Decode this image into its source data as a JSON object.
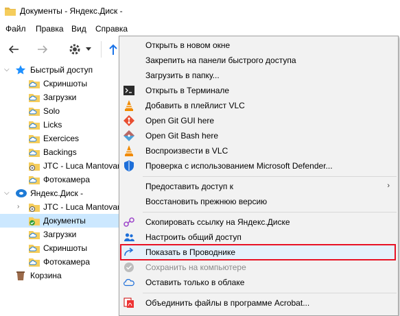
{
  "window": {
    "title": "Документы - Яндекс.Диск -"
  },
  "menu": [
    "Файл",
    "Правка",
    "Вид",
    "Справка"
  ],
  "nav": {
    "quick_access": "Быстрый доступ",
    "quick_items": [
      "Скриншоты",
      "Загрузки",
      "Solo",
      "Licks",
      "Exercices",
      "Backings",
      "JTC - Luca Mantovan",
      "Фотокамера"
    ],
    "yandex_disk": "Яндекс.Диск -",
    "disk_items": [
      "JTC - Luca Mantovan",
      "Документы",
      "Загрузки",
      "Скриншоты",
      "Фотокамера"
    ],
    "recycle_bin": "Корзина"
  },
  "context_menu": {
    "group1": [
      "Открыть в новом окне",
      "Закрепить на панели быстрого доступа",
      "Загрузить в папку...",
      "Открыть в Терминале",
      "Добавить в плейлист VLC",
      "Open Git GUI here",
      "Open Git Bash here",
      "Воспроизвести в VLC",
      "Проверка с использованием Microsoft Defender..."
    ],
    "group2": [
      "Предоставить доступ к",
      "Восстановить прежнюю версию"
    ],
    "group3": [
      "Скопировать ссылку на Яндекс.Диске",
      "Настроить общий доступ",
      "Показать в Проводнике",
      "Сохранить на компьютере",
      "Оставить только в облаке"
    ],
    "group4": [
      "Объединить файлы в программе Acrobat..."
    ]
  },
  "colors": {
    "selected_bg": "#cce8ff",
    "highlight_border": "#e81123",
    "menu_bg": "#f2f2f2"
  }
}
